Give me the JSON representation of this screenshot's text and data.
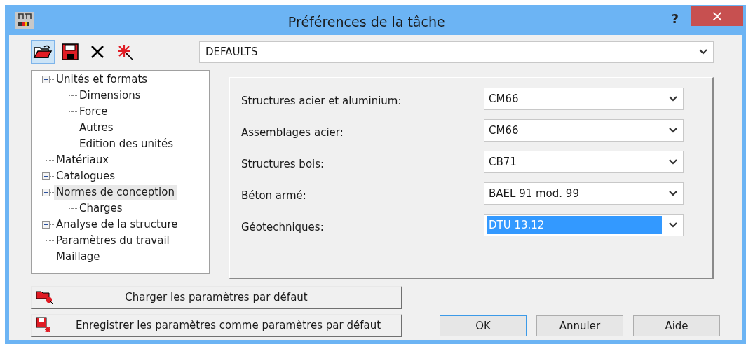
{
  "window": {
    "title": "Préférences de la tâche",
    "help": "?",
    "close": "×"
  },
  "toolbar": [
    {
      "kind": "open",
      "pressed": true
    },
    {
      "kind": "save",
      "pressed": false
    },
    {
      "kind": "delete",
      "pressed": false
    },
    {
      "kind": "new",
      "pressed": false
    }
  ],
  "profile": {
    "value": "DEFAULTS"
  },
  "tree": [
    {
      "label": "Unités et formats",
      "expanded": true,
      "selected": false,
      "children": [
        {
          "label": "Dimensions",
          "selected": false
        },
        {
          "label": "Force",
          "selected": false
        },
        {
          "label": "Autres",
          "selected": false
        },
        {
          "label": "Edition des unités",
          "selected": false
        }
      ]
    },
    {
      "label": "Matériaux",
      "selected": false
    },
    {
      "label": "Catalogues",
      "expanded": false,
      "selected": false
    },
    {
      "label": "Normes de conception",
      "expanded": true,
      "selected": true,
      "children": [
        {
          "label": "Charges",
          "selected": false
        }
      ]
    },
    {
      "label": "Analyse de la structure",
      "expanded": false,
      "selected": false
    },
    {
      "label": "Paramètres du travail",
      "selected": false
    },
    {
      "label": "Maillage",
      "selected": false
    }
  ],
  "settings": [
    {
      "label": "Structures acier et aluminium:",
      "value": "CM66",
      "focused": false
    },
    {
      "label": "Assemblages acier:",
      "value": "CM66",
      "focused": false
    },
    {
      "label": "Structures bois:",
      "value": "CB71",
      "focused": false
    },
    {
      "label": "Béton armé:",
      "value": "BAEL 91 mod. 99",
      "focused": false
    },
    {
      "label": "Géotechniques:",
      "value": "DTU 13.12",
      "focused": true
    }
  ],
  "default_buttons": [
    {
      "kind": "load",
      "label": "Charger les paramètres par défaut"
    },
    {
      "kind": "store",
      "label": "Enregistrer les paramètres comme paramètres par défaut"
    }
  ],
  "buttons": [
    {
      "label": "OK",
      "default": true
    },
    {
      "label": "Annuler",
      "default": false
    },
    {
      "label": "Aide",
      "default": false
    }
  ]
}
